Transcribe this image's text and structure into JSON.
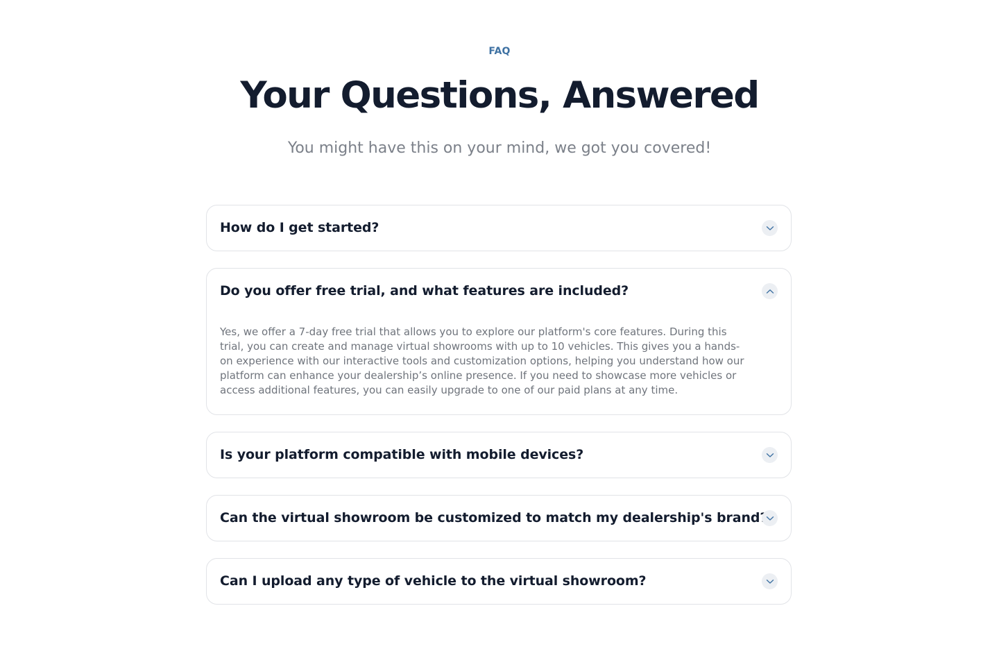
{
  "header": {
    "eyebrow": "FAQ",
    "title": "Your Questions, Answered",
    "subtitle": "You might have this on your mind, we got you covered!"
  },
  "faq": [
    {
      "question": "How do I get started?",
      "expanded": false,
      "icon": "chevron-down-icon"
    },
    {
      "question": "Do you offer free trial, and what features are included?",
      "expanded": true,
      "icon": "chevron-up-icon",
      "answer": "Yes, we offer a 7-day free trial that allows you to explore our platform's core features. During this trial, you can create and manage virtual showrooms with up to 10 vehicles. This gives you a hands-on experience with our interactive tools and customization options, helping you understand how our platform can enhance your dealership’s online presence. If you need to showcase more vehicles or access additional features, you can easily upgrade to one of our paid plans at any time."
    },
    {
      "question": "Is your platform compatible with mobile devices?",
      "expanded": false,
      "icon": "chevron-down-icon"
    },
    {
      "question": "Can the virtual showroom be customized to match my dealership's brand?",
      "expanded": false,
      "icon": "chevron-down-icon"
    },
    {
      "question": "Can I upload any type of vehicle to the virtual showroom?",
      "expanded": false,
      "icon": "chevron-down-icon"
    }
  ],
  "colors": {
    "accent": "#3f72a3",
    "heading": "#131c2e",
    "muted": "#7b8089",
    "border": "#e1e3e7",
    "icon_bg": "#eceff3"
  }
}
